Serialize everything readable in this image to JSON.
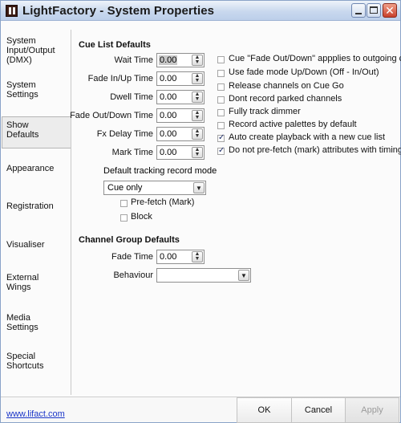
{
  "window": {
    "title": "LightFactory - System Properties"
  },
  "nav": {
    "items": [
      {
        "label": "System Input/Output (DMX)"
      },
      {
        "label": "System Settings"
      },
      {
        "label": "Show Defaults",
        "selected": true
      },
      {
        "label": "Appearance"
      },
      {
        "label": "Registration"
      },
      {
        "label": "Visualiser"
      },
      {
        "label": "External Wings"
      },
      {
        "label": "Media Settings"
      },
      {
        "label": "Special Shortcuts"
      }
    ]
  },
  "cue_list": {
    "heading": "Cue List Defaults",
    "fields": [
      {
        "label": "Wait Time",
        "value": "0.00",
        "active": true
      },
      {
        "label": "Fade In/Up Time",
        "value": "0.00"
      },
      {
        "label": "Dwell Time",
        "value": "0.00"
      },
      {
        "label": "Fade Out/Down Time",
        "value": "0.00"
      },
      {
        "label": "Fx Delay Time",
        "value": "0.00"
      },
      {
        "label": "Mark Time",
        "value": "0.00"
      }
    ],
    "tracking_label": "Default tracking record mode",
    "tracking_value": "Cue only",
    "prefetch_label": "Pre-fetch (Mark)",
    "block_label": "Block",
    "options": [
      {
        "label": "Cue \"Fade Out/Down\" appplies to outgoing cue",
        "checked": false
      },
      {
        "label": "Use fade mode Up/Down (Off - In/Out)",
        "checked": false
      },
      {
        "label": "Release channels on Cue Go",
        "checked": false
      },
      {
        "label": "Dont record parked channels",
        "checked": false
      },
      {
        "label": "Fully track dimmer",
        "checked": false
      },
      {
        "label": "Record active palettes by default",
        "checked": false
      },
      {
        "label": "Auto create playback with a new cue list",
        "checked": true
      },
      {
        "label": "Do not pre-fetch (mark) attributes with timing",
        "checked": true
      }
    ]
  },
  "channel_group": {
    "heading": "Channel Group Defaults",
    "fade_label": "Fade Time",
    "fade_value": "0.00",
    "behaviour_label": "Behaviour",
    "behaviour_value": ""
  },
  "footer": {
    "link": "www.lifact.com",
    "ok": "OK",
    "cancel": "Cancel",
    "apply": "Apply"
  }
}
